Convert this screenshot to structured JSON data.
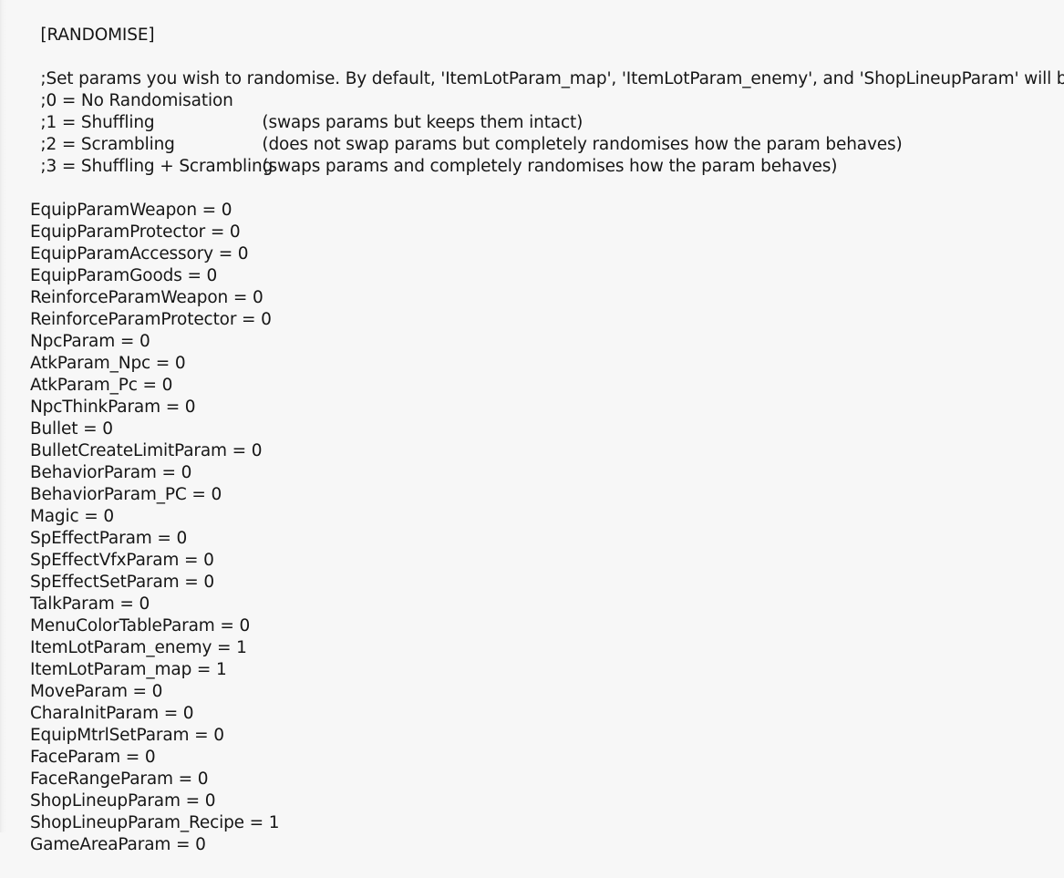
{
  "document": {
    "section_header": "[RANDOMISE]",
    "comments": {
      "intro": ";Set params you wish to randomise. By default, 'ItemLotParam_map', 'ItemLotParam_enemy', and 'ShopLineupParam' will be shuffled",
      "modes": [
        {
          "label": ";0 = No Randomisation",
          "description": ""
        },
        {
          "label": ";1 = Shuffling",
          "description": "(swaps params but keeps them intact)"
        },
        {
          "label": ";2 = Scrambling",
          "description": "(does not swap params but completely randomises how the param behaves)"
        },
        {
          "label": ";3 = Shuffling + Scrambling",
          "description": "(swaps params and completely randomises how the param behaves)"
        }
      ]
    },
    "settings": [
      {
        "key": "EquipParamWeapon",
        "value": "0"
      },
      {
        "key": "EquipParamProtector",
        "value": "0"
      },
      {
        "key": "EquipParamAccessory",
        "value": "0"
      },
      {
        "key": "EquipParamGoods",
        "value": "0"
      },
      {
        "key": "ReinforceParamWeapon",
        "value": "0"
      },
      {
        "key": "ReinforceParamProtector",
        "value": "0"
      },
      {
        "key": "NpcParam",
        "value": "0"
      },
      {
        "key": "AtkParam_Npc",
        "value": "0"
      },
      {
        "key": "AtkParam_Pc",
        "value": "0"
      },
      {
        "key": "NpcThinkParam",
        "value": "0"
      },
      {
        "key": "Bullet",
        "value": "0"
      },
      {
        "key": "BulletCreateLimitParam",
        "value": "0"
      },
      {
        "key": "BehaviorParam",
        "value": "0"
      },
      {
        "key": "BehaviorParam_PC",
        "value": "0"
      },
      {
        "key": "Magic",
        "value": "0"
      },
      {
        "key": "SpEffectParam",
        "value": "0"
      },
      {
        "key": "SpEffectVfxParam",
        "value": "0"
      },
      {
        "key": "SpEffectSetParam",
        "value": "0"
      },
      {
        "key": "TalkParam",
        "value": "0"
      },
      {
        "key": "MenuColorTableParam",
        "value": "0"
      },
      {
        "key": "ItemLotParam_enemy",
        "value": "1"
      },
      {
        "key": "ItemLotParam_map",
        "value": "1"
      },
      {
        "key": "MoveParam",
        "value": "0"
      },
      {
        "key": "CharaInitParam",
        "value": "0"
      },
      {
        "key": "EquipMtrlSetParam",
        "value": "0"
      },
      {
        "key": "FaceParam",
        "value": "0"
      },
      {
        "key": "FaceRangeParam",
        "value": "0"
      },
      {
        "key": "ShopLineupParam",
        "value": "0"
      },
      {
        "key": "ShopLineupParam_Recipe",
        "value": "1"
      },
      {
        "key": "GameAreaParam",
        "value": "0"
      }
    ],
    "assignment_operator": "=",
    "colors": {
      "background": "#f7f7f7",
      "text": "#161616"
    }
  }
}
